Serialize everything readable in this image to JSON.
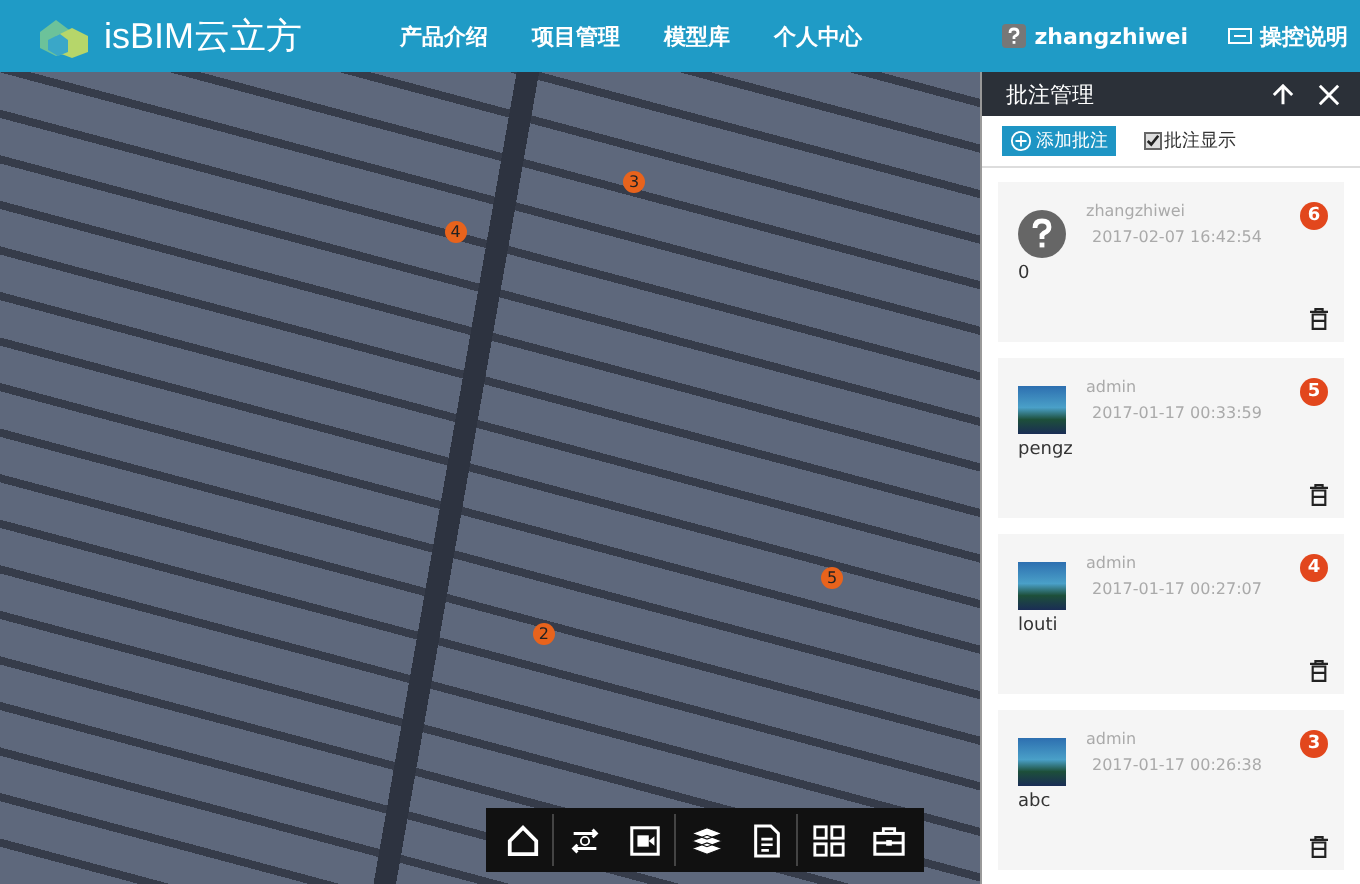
{
  "header": {
    "brand": "isBIM云立方",
    "nav": [
      "产品介绍",
      "项目管理",
      "模型库",
      "个人中心"
    ],
    "user": "zhangzhiwei",
    "help": "操控说明"
  },
  "viewer": {
    "pins": [
      {
        "label": "3"
      },
      {
        "label": "4"
      },
      {
        "label": "5"
      },
      {
        "label": "2"
      }
    ]
  },
  "panel": {
    "title": "批注管理",
    "add_button": "添加批注",
    "show_checkbox": {
      "label": "批注显示",
      "checked": true
    },
    "comments": [
      {
        "kind": "unknown",
        "user": "zhangzhiwei",
        "time": "2017-02-07 16:42:54",
        "number": "6",
        "text": "0"
      },
      {
        "kind": "photo",
        "user": "admin",
        "time": "2017-01-17 00:33:59",
        "number": "5",
        "text": "pengz"
      },
      {
        "kind": "photo",
        "user": "admin",
        "time": "2017-01-17 00:27:07",
        "number": "4",
        "text": "louti"
      },
      {
        "kind": "photo",
        "user": "admin",
        "time": "2017-01-17 00:26:38",
        "number": "3",
        "text": "abc"
      }
    ]
  }
}
